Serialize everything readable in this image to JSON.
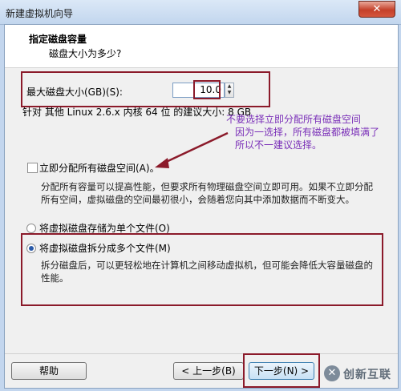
{
  "window": {
    "title": "新建虚拟机向导",
    "close": "✕"
  },
  "header": {
    "title": "指定磁盘容量",
    "subtitle": "磁盘大小为多少?"
  },
  "disk": {
    "max_label": "最大磁盘大小(GB)(S):",
    "value": "10.0",
    "recommend": "针对 其他 Linux 2.6.x 内核 64 位 的建议大小: 8 GB"
  },
  "annotation": {
    "line1": "不要选择立即分配所有磁盘空间",
    "line2": "因为一选择，所有磁盘都被填满了",
    "line3": "所以不一建议选择。"
  },
  "allocate": {
    "label": "立即分配所有磁盘空间(A)。",
    "checked": false,
    "desc_line1": "分配所有容量可以提高性能，但要求所有物理磁盘空间立即可用。如果不立即分配",
    "desc_line2": "所有空间，虚拟磁盘的空间最初很小，会随着您向其中添加数据而不断变大。"
  },
  "storage": {
    "single_label": "将虚拟磁盘存储为单个文件(O)",
    "split_label": "将虚拟磁盘拆分成多个文件(M)",
    "selected": "split",
    "split_desc_line1": "拆分磁盘后，可以更轻松地在计算机之间移动虚拟机，但可能会降低大容量磁盘的",
    "split_desc_line2": "性能。"
  },
  "buttons": {
    "help": "帮助",
    "back": "< 上一步(B)",
    "next": "下一步(N) >"
  },
  "watermark": {
    "icon": "✕",
    "text": "创新互联"
  },
  "colors": {
    "annotation_border": "#8b1a2a",
    "annotation_text": "#7a2fb8"
  }
}
